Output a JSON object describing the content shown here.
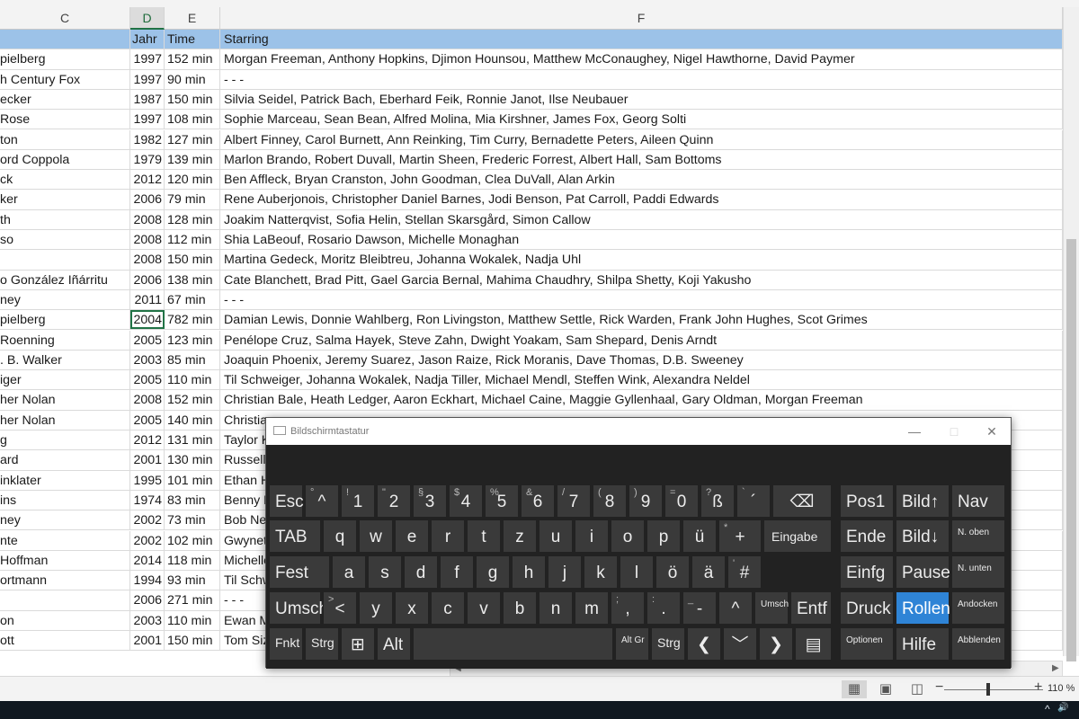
{
  "columns": {
    "c": "C",
    "d": "D",
    "e": "E",
    "f": "F"
  },
  "header": {
    "c": "",
    "d": "Jahr",
    "e": "Time",
    "f": "Starring"
  },
  "rows": [
    {
      "c": "pielberg",
      "d": "1997",
      "e": "152 min",
      "f": "Morgan Freeman, Anthony Hopkins, Djimon Hounsou, Matthew McConaughey, Nigel Hawthorne, David Paymer"
    },
    {
      "c": "h Century Fox",
      "d": "1997",
      "e": "90 min",
      "f": "- - -"
    },
    {
      "c": "ecker",
      "d": "1987",
      "e": "150 min",
      "f": "Silvia Seidel, Patrick Bach, Eberhard Feik, Ronnie Janot, Ilse Neubauer"
    },
    {
      "c": "Rose",
      "d": "1997",
      "e": "108 min",
      "f": "Sophie Marceau, Sean Bean, Alfred Molina, Mia Kirshner, James Fox, Georg Solti"
    },
    {
      "c": "ton",
      "d": "1982",
      "e": "127 min",
      "f": "Albert Finney, Carol Burnett, Ann Reinking, Tim Curry, Bernadette Peters, Aileen Quinn"
    },
    {
      "c": "ord Coppola",
      "d": "1979",
      "e": "139 min",
      "f": "Marlon Brando, Robert Duvall, Martin Sheen, Frederic Forrest, Albert Hall, Sam Bottoms"
    },
    {
      "c": "ck",
      "d": "2012",
      "e": "120 min",
      "f": "Ben Affleck, Bryan Cranston, John Goodman, Clea DuVall, Alan Arkin"
    },
    {
      "c": "ker",
      "d": "2006",
      "e": "79 min",
      "f": "Rene Auberjonois, Christopher Daniel Barnes, Jodi Benson, Pat Carroll, Paddi Edwards"
    },
    {
      "c": "th",
      "d": "2008",
      "e": "128 min",
      "f": "Joakim Natterqvist, Sofia Helin, Stellan Skarsgård, Simon Callow"
    },
    {
      "c": "so",
      "d": "2008",
      "e": "112 min",
      "f": "Shia LaBeouf, Rosario Dawson, Michelle Monaghan"
    },
    {
      "c": "",
      "d": "2008",
      "e": "150 min",
      "f": "Martina Gedeck, Moritz Bleibtreu, Johanna Wokalek, Nadja Uhl"
    },
    {
      "c": "o González Iñárritu",
      "d": "2006",
      "e": "138 min",
      "f": "Cate Blanchett, Brad Pitt, Gael Garcia Bernal, Mahima Chaudhry, Shilpa Shetty, Koji Yakusho"
    },
    {
      "c": "ney",
      "d": "2011",
      "e": "67 min",
      "f": "- - -"
    },
    {
      "c": "pielberg",
      "d": "2004",
      "e": "782 min",
      "f": "Damian Lewis, Donnie Wahlberg, Ron Livingston, Matthew Settle, Rick Warden, Frank John Hughes, Scot Grimes",
      "active": true
    },
    {
      "c": "Roenning",
      "d": "2005",
      "e": "123 min",
      "f": "Penélope Cruz, Salma Hayek, Steve Zahn, Dwight Yoakam, Sam Shepard, Denis Arndt"
    },
    {
      "c": ". B. Walker",
      "d": "2003",
      "e": "85 min",
      "f": "Joaquin Phoenix, Jeremy Suarez, Jason Raize, Rick Moranis, Dave Thomas, D.B. Sweeney"
    },
    {
      "c": "iger",
      "d": "2005",
      "e": "110 min",
      "f": "Til Schweiger, Johanna Wokalek, Nadja Tiller, Michael Mendl, Steffen Wink, Alexandra Neldel"
    },
    {
      "c": "her Nolan",
      "d": "2008",
      "e": "152 min",
      "f": "Christian Bale, Heath Ledger, Aaron Eckhart, Michael Caine, Maggie Gyllenhaal, Gary Oldman, Morgan Freeman"
    },
    {
      "c": "her Nolan",
      "d": "2005",
      "e": "140 min",
      "f": "Christia"
    },
    {
      "c": "g",
      "d": "2012",
      "e": "131 min",
      "f": "Taylor K"
    },
    {
      "c": "ard",
      "d": "2001",
      "e": "130 min",
      "f": "Russell"
    },
    {
      "c": "inklater",
      "d": "1995",
      "e": "101 min",
      "f": "Ethan H"
    },
    {
      "c": "ins",
      "d": "1974",
      "e": "83 min",
      "f": "Benny H"
    },
    {
      "c": "ney",
      "d": "2002",
      "e": "73 min",
      "f": "Bob Nev"
    },
    {
      "c": "nte",
      "d": "2002",
      "e": "102 min",
      "f": "Gwynet"
    },
    {
      "c": "Hoffman",
      "d": "2014",
      "e": "118 min",
      "f": "Michelle"
    },
    {
      "c": "ortmann",
      "d": "1994",
      "e": "93 min",
      "f": "Til Schw"
    },
    {
      "c": "",
      "d": "2006",
      "e": "271 min",
      "f": "- - -"
    },
    {
      "c": "on",
      "d": "2003",
      "e": "110 min",
      "f": "Ewan M"
    },
    {
      "c": "ott",
      "d": "2001",
      "e": "150 min",
      "f": "Tom Siz"
    }
  ],
  "status": {
    "zoom": "110 %",
    "zoom_minus": "−",
    "zoom_plus": "+"
  },
  "tray": {
    "icons": [
      "chevron-up-icon",
      "speaker-icon"
    ],
    "chevron": "^",
    "speaker": "🔊"
  },
  "osk": {
    "title": "Bildschirmtastatur",
    "minimize": "—",
    "maximize": "□",
    "close": "✕",
    "keys": [
      {
        "id": "esc",
        "main": "Esc"
      },
      {
        "id": "k1",
        "sec": "°",
        "main": "^"
      },
      {
        "id": "k2",
        "sec": "!",
        "main": "1"
      },
      {
        "id": "k3",
        "sec": "\"",
        "main": "2"
      },
      {
        "id": "k4",
        "sec": "§",
        "main": "3"
      },
      {
        "id": "k5",
        "sec": "$",
        "main": "4"
      },
      {
        "id": "k6",
        "sec": "%",
        "main": "5"
      },
      {
        "id": "k7",
        "sec": "&",
        "main": "6"
      },
      {
        "id": "k8",
        "sec": "/",
        "main": "7"
      },
      {
        "id": "k9",
        "sec": "(",
        "main": "8"
      },
      {
        "id": "k10",
        "sec": ")",
        "main": "9"
      },
      {
        "id": "k11",
        "sec": "=",
        "main": "0"
      },
      {
        "id": "k12",
        "sec": "?",
        "main": "ß"
      },
      {
        "id": "k13",
        "sec": "`",
        "main": "´"
      },
      {
        "id": "bksp",
        "main": "⌫"
      },
      {
        "id": "pos1",
        "main": "Pos1"
      },
      {
        "id": "bildup",
        "main": "Bild↑"
      },
      {
        "id": "nav",
        "main": "Nav"
      },
      {
        "id": "tab",
        "main": "TAB"
      },
      {
        "id": "q",
        "main": "q"
      },
      {
        "id": "w",
        "main": "w"
      },
      {
        "id": "e",
        "main": "e"
      },
      {
        "id": "r",
        "main": "r"
      },
      {
        "id": "t",
        "main": "t"
      },
      {
        "id": "z",
        "main": "z"
      },
      {
        "id": "u",
        "main": "u"
      },
      {
        "id": "i",
        "main": "i"
      },
      {
        "id": "o",
        "main": "o"
      },
      {
        "id": "p",
        "main": "p"
      },
      {
        "id": "ue",
        "main": "ü"
      },
      {
        "id": "plus",
        "sec": "*",
        "main": "+"
      },
      {
        "id": "eingabe",
        "main": "Eingabe"
      },
      {
        "id": "ende",
        "main": "Ende"
      },
      {
        "id": "bilddown",
        "main": "Bild↓"
      },
      {
        "id": "noben",
        "main": "N. oben"
      },
      {
        "id": "fest",
        "main": "Fest"
      },
      {
        "id": "a",
        "main": "a"
      },
      {
        "id": "s",
        "main": "s"
      },
      {
        "id": "d",
        "main": "d"
      },
      {
        "id": "f",
        "main": "f"
      },
      {
        "id": "g",
        "main": "g"
      },
      {
        "id": "h",
        "main": "h"
      },
      {
        "id": "j",
        "main": "j"
      },
      {
        "id": "k",
        "main": "k"
      },
      {
        "id": "l",
        "main": "l"
      },
      {
        "id": "oe",
        "main": "ö"
      },
      {
        "id": "ae",
        "main": "ä"
      },
      {
        "id": "hash",
        "sec": "'",
        "main": "#"
      },
      {
        "id": "einfg",
        "main": "Einfg"
      },
      {
        "id": "pause",
        "main": "Pause"
      },
      {
        "id": "nunten",
        "main": "N. unten"
      },
      {
        "id": "umsch",
        "main": "Umsch"
      },
      {
        "id": "lt",
        "sec": ">",
        "main": "<"
      },
      {
        "id": "y",
        "main": "y"
      },
      {
        "id": "x",
        "main": "x"
      },
      {
        "id": "c",
        "main": "c"
      },
      {
        "id": "v",
        "main": "v"
      },
      {
        "id": "b",
        "main": "b"
      },
      {
        "id": "n",
        "main": "n"
      },
      {
        "id": "m",
        "main": "m"
      },
      {
        "id": "comma",
        "sec": ";",
        "main": ","
      },
      {
        "id": "period",
        "sec": ":",
        "main": "."
      },
      {
        "id": "minus",
        "sec": "_",
        "main": "-"
      },
      {
        "id": "up",
        "main": "^"
      },
      {
        "id": "umsch2",
        "main": "Umsch"
      },
      {
        "id": "entf",
        "main": "Entf"
      },
      {
        "id": "druck",
        "main": "Druck"
      },
      {
        "id": "rollen",
        "main": "Rollen"
      },
      {
        "id": "andocken",
        "main": "Andocken"
      },
      {
        "id": "fnkt",
        "main": "Fnkt"
      },
      {
        "id": "strg",
        "main": "Strg"
      },
      {
        "id": "win",
        "main": "⊞"
      },
      {
        "id": "alt",
        "main": "Alt"
      },
      {
        "id": "space",
        "main": ""
      },
      {
        "id": "altgr",
        "main": "Alt Gr"
      },
      {
        "id": "strg2",
        "main": "Strg"
      },
      {
        "id": "left",
        "main": "❮"
      },
      {
        "id": "down",
        "main": "﹀"
      },
      {
        "id": "right",
        "main": "❯"
      },
      {
        "id": "menu",
        "main": "▤"
      },
      {
        "id": "optionen",
        "main": "Optionen"
      },
      {
        "id": "hilfe",
        "main": "Hilfe"
      },
      {
        "id": "abblenden",
        "main": "Abblenden"
      }
    ]
  }
}
